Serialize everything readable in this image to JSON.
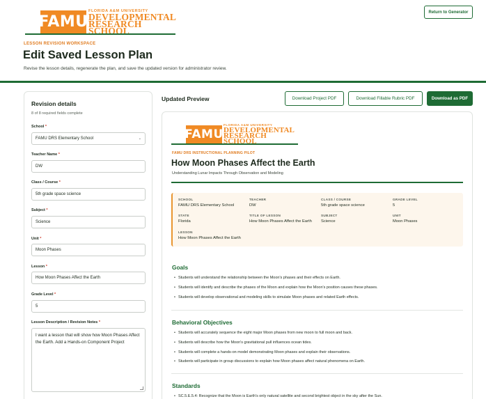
{
  "header": {
    "logo": {
      "mark": "FAMU",
      "university": "FLORIDA A&M UNIVERSITY",
      "school_line1": "DEVELOPMENTAL",
      "school_line2": "RESEARCH",
      "school_line3": "SCHOOL"
    },
    "return_label": "Return to Generator",
    "eyebrow": "LESSON REVISION WORKSPACE",
    "title": "Edit Saved Lesson Plan",
    "subtitle": "Revise the lesson details, regenerate the plan, and save the updated version for administrator review."
  },
  "revision": {
    "title": "Revision details",
    "count": "8 of 8 required fields complete",
    "fields": {
      "school": {
        "label": "School",
        "value": "FAMU DRS Elementary School"
      },
      "teacher": {
        "label": "Teacher Name",
        "value": "DW"
      },
      "class": {
        "label": "Class / Course",
        "value": "5th grade space science"
      },
      "subject": {
        "label": "Subject",
        "value": "Science"
      },
      "unit": {
        "label": "Unit",
        "value": "Moon Phases"
      },
      "lesson": {
        "label": "Lesson",
        "value": "How Moon Phases Affect the Earth"
      },
      "grade": {
        "label": "Grade Level",
        "value": "5"
      },
      "description": {
        "label": "Lesson Description / Revision Notes",
        "value": "I want a lesson that will show how Moon Phases Affect the Earth. Add a Hands-on Component Project"
      }
    },
    "required_mark": "*"
  },
  "preview": {
    "heading": "Updated Preview",
    "buttons": {
      "project_pdf": "Download Project PDF",
      "rubric_pdf": "Download Fillable Rubric PDF",
      "download_pdf": "Download as PDF"
    },
    "eyebrow": "FAMU DRS INSTRUCTIONAL PLANNING PILOT",
    "title": "How Moon Phases Affect the Earth",
    "subtitle": "Understanding Lunar Impacts Through Observation and Modeling",
    "meta": [
      {
        "label": "SCHOOL",
        "value": "FAMU DRS Elementary School"
      },
      {
        "label": "TEACHER",
        "value": "DW"
      },
      {
        "label": "CLASS / COURSE",
        "value": "5th grade space science"
      },
      {
        "label": "GRADE LEVEL",
        "value": "5"
      },
      {
        "label": "STATE",
        "value": "Florida"
      },
      {
        "label": "TITLE OF LESSON",
        "value": "How Moon Phases Affect the Earth"
      },
      {
        "label": "SUBJECT",
        "value": "Science"
      },
      {
        "label": "UNIT",
        "value": "Moon Phases"
      },
      {
        "label": "LESSON",
        "value": "How Moon Phases Affect the Earth"
      }
    ],
    "goals": {
      "title": "Goals",
      "items": [
        "Students will understand the relationship between the Moon's phases and their effects on Earth.",
        "Students will identify and describe the phases of the Moon and explain how the Moon's position causes these phases.",
        "Students will develop observational and modeling skills to simulate Moon phases and related Earth effects."
      ]
    },
    "objectives": {
      "title": "Behavioral Objectives",
      "items": [
        "Students will accurately sequence the eight major Moon phases from new moon to full moon and back.",
        "Students will describe how the Moon's gravitational pull influences ocean tides.",
        "Students will complete a hands-on model demonstrating Moon phases and explain their observations.",
        "Students will participate in group discussions to explain how Moon phases affect natural phenomena on Earth."
      ]
    },
    "standards": {
      "title": "Standards",
      "items": [
        "SC.5.E.5.4: Recognize that the Moon is Earth's only natural satellite and second brightest object in the sky after the Sun."
      ]
    }
  },
  "colors": {
    "brand_green": "#1e6b34",
    "brand_orange": "#f08a24",
    "meta_bg": "#fdf6ec"
  }
}
